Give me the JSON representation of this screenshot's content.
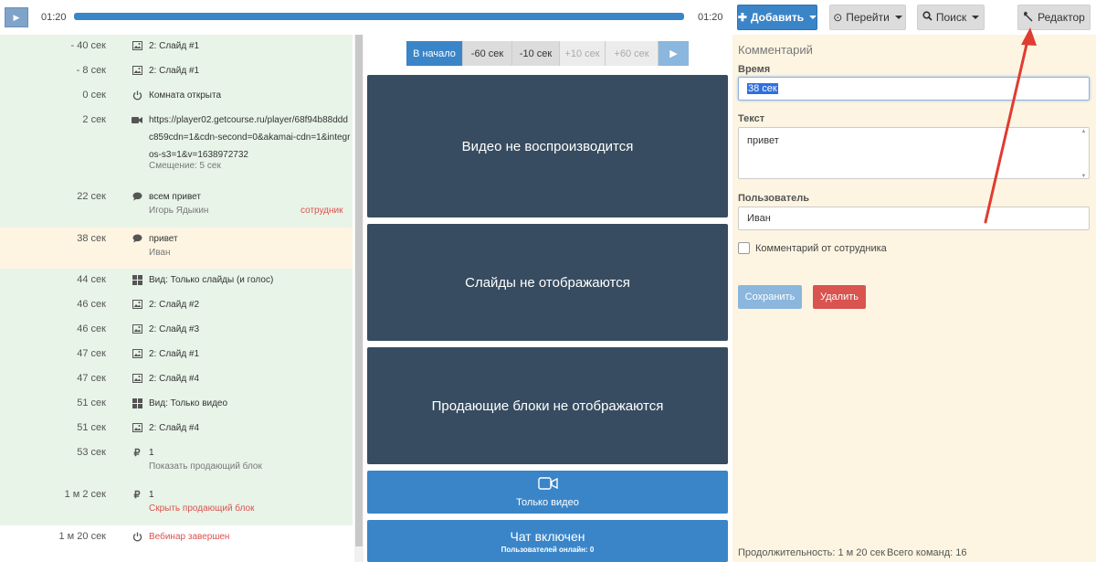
{
  "topbar": {
    "time_current": "01:20",
    "time_total": "01:20",
    "progress_fraction": 1.0,
    "add_label": "Добавить",
    "goto_label": "Перейти",
    "search_label": "Поиск",
    "editor_label": "Редактор"
  },
  "events": [
    {
      "time": "- 40 сек",
      "icon": "image-icon",
      "text": "2: Слайд #1",
      "bg": "#e8f4e8"
    },
    {
      "time": "- 8 сек",
      "icon": "image-icon",
      "text": "2: Слайд #1",
      "bg": "#e8f4e8"
    },
    {
      "time": "0 сек",
      "icon": "power-icon",
      "text": "Комната открыта",
      "bg": "#e8f4e8"
    },
    {
      "time": "2 сек",
      "icon": "video-camera-icon",
      "text": "https://player02.getcourse.ru/player/68f94b88dddc859cdn=1&cdn-second=0&akamai-cdn=1&integros-s3=1&v=1638972732",
      "sub": "Смещение: 5 сек",
      "bg": "#e8f4e8"
    },
    {
      "time": "22 сек",
      "icon": "chat-bubble-icon",
      "text": "всем привет",
      "sub": "Игорь Ядыкин",
      "role": "сотрудник",
      "bg": "#e8f4e8"
    },
    {
      "time": "38 сек",
      "icon": "chat-bubble-icon",
      "text": "привет",
      "sub": "Иван",
      "bg": "#fdf5e2"
    },
    {
      "time": "44 сек",
      "icon": "grid-icon",
      "text": "Вид: Только слайды (и голос)",
      "bg": "#e8f4e8"
    },
    {
      "time": "46 сек",
      "icon": "image-icon",
      "text": "2: Слайд #2",
      "bg": "#e8f4e8"
    },
    {
      "time": "46 сек",
      "icon": "image-icon",
      "text": "2: Слайд #3",
      "bg": "#e8f4e8"
    },
    {
      "time": "47 сек",
      "icon": "image-icon",
      "text": "2: Слайд #1",
      "bg": "#e8f4e8"
    },
    {
      "time": "47 сек",
      "icon": "image-icon",
      "text": "2: Слайд #4",
      "bg": "#e8f4e8"
    },
    {
      "time": "51 сек",
      "icon": "grid-icon",
      "text": "Вид: Только видео",
      "bg": "#e8f4e8"
    },
    {
      "time": "51 сек",
      "icon": "image-icon",
      "text": "2: Слайд #4",
      "bg": "#e8f4e8"
    },
    {
      "time": "53 сек",
      "icon": "ruble-icon",
      "text": "1",
      "sub": "Показать продающий блок",
      "bg": "#e8f4e8"
    },
    {
      "time": "1 м 2 сек",
      "icon": "ruble-icon",
      "text": "1",
      "sub": "Скрыть продающий блок",
      "sub_red": true,
      "bg": "#e8f4e8"
    },
    {
      "time": "1 м 20 сек",
      "icon": "power-icon",
      "text": "Вебинар завершен",
      "text_red": true,
      "bg": "#ffffff"
    }
  ],
  "nav": {
    "start": "В начало",
    "minus60": "-60 сек",
    "minus10": "-10 сек",
    "plus10": "+10 сек",
    "plus60": "+60 сек"
  },
  "panels": {
    "video": "Видео не воспроизводится",
    "slides": "Слайды не отображаются",
    "selling": "Продающие блоки не отображаются",
    "only_video": "Только видео",
    "chat": "Чат включен",
    "online": "Пользователей онлайн: 0"
  },
  "comment": {
    "title": "Комментарий",
    "time_label": "Время",
    "time_value": "38 сек",
    "text_label": "Текст",
    "text_value": "привет",
    "user_label": "Пользователь",
    "user_value": "Иван",
    "staff_label": "Комментарий от сотрудника",
    "save": "Сохранить",
    "delete": "Удалить"
  },
  "footer": {
    "duration": "Продолжительность: 1 м 20 сек",
    "commands": "Всего команд: 16"
  },
  "colors": {
    "accent": "#3a85c8",
    "danger": "#d9534f",
    "panel": "#374c60",
    "annotation_arrow": "#e03c31"
  }
}
